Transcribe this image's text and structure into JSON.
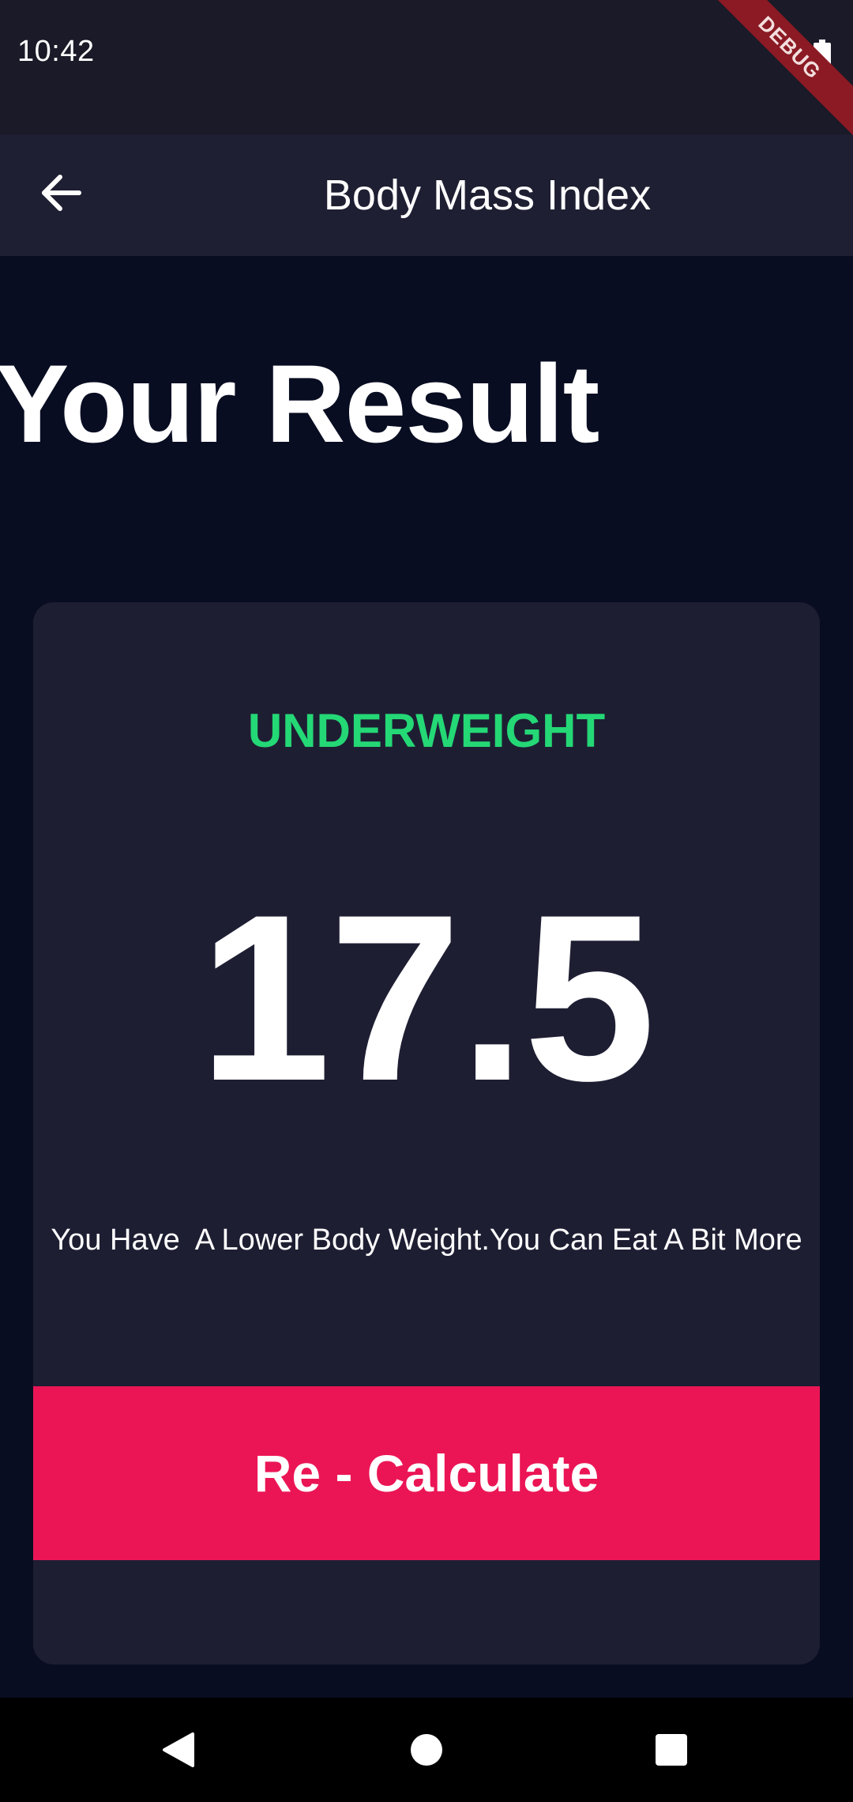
{
  "status_bar": {
    "time": "10:42",
    "debug_label": "DEBUG"
  },
  "app_bar": {
    "title": "Body Mass Index",
    "back_icon": "arrow-back-icon"
  },
  "page": {
    "heading": "Your Result"
  },
  "result": {
    "status": "UNDERWEIGHT",
    "bmi_value": "17.5",
    "advice": "You Have  A Lower Body Weight.You Can Eat A Bit More",
    "button_label": "Re - Calculate"
  },
  "nav_bar": {
    "icons": [
      "nav-back-icon",
      "nav-home-icon",
      "nav-recents-icon"
    ]
  },
  "colors": {
    "background": "#090d22",
    "card": "#1e1e33",
    "app_bar": "#1f1f33",
    "status_text": "#24d876",
    "button": "#eb1555"
  }
}
